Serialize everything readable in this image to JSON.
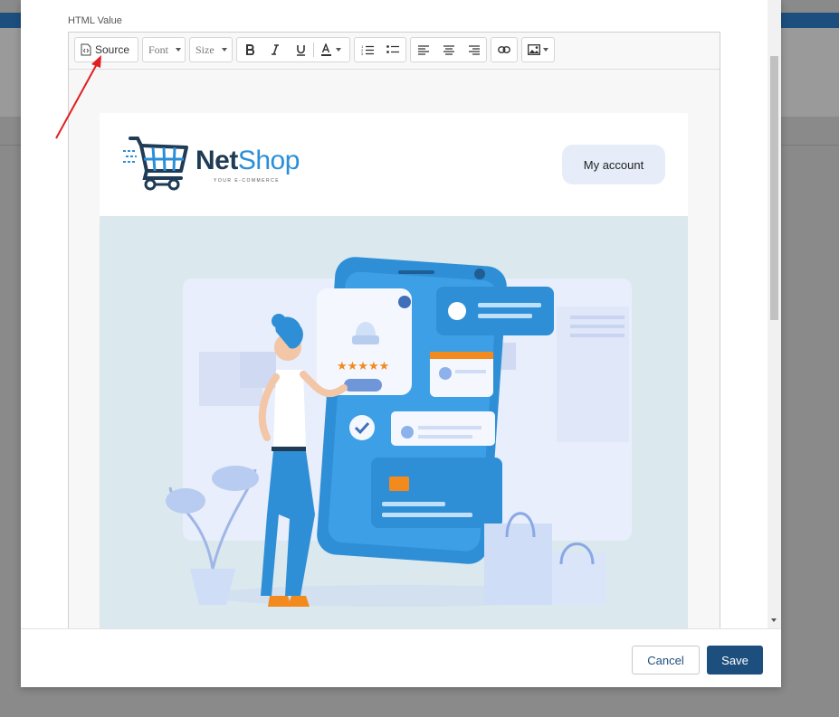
{
  "editor": {
    "field_label": "HTML Value",
    "toolbar": {
      "source_label": "Source",
      "font_label": "Font",
      "size_label": "Size"
    }
  },
  "email": {
    "logo": {
      "name_part1": "Net",
      "name_part2": "Shop",
      "tagline": "YOUR E-COMMERCE"
    },
    "account_button": "My account"
  },
  "footer": {
    "cancel_label": "Cancel",
    "save_label": "Save"
  },
  "colors": {
    "primary": "#1d4f7e",
    "annotation_arrow": "#e02020",
    "hero_bg": "#dbe8ee",
    "logo_blue": "#2b8fd8"
  },
  "icons": [
    "source-icon",
    "bold-icon",
    "italic-icon",
    "underline-icon",
    "text-color-icon",
    "ordered-list-icon",
    "unordered-list-icon",
    "align-left-icon",
    "align-center-icon",
    "align-right-icon",
    "link-icon",
    "image-icon"
  ]
}
